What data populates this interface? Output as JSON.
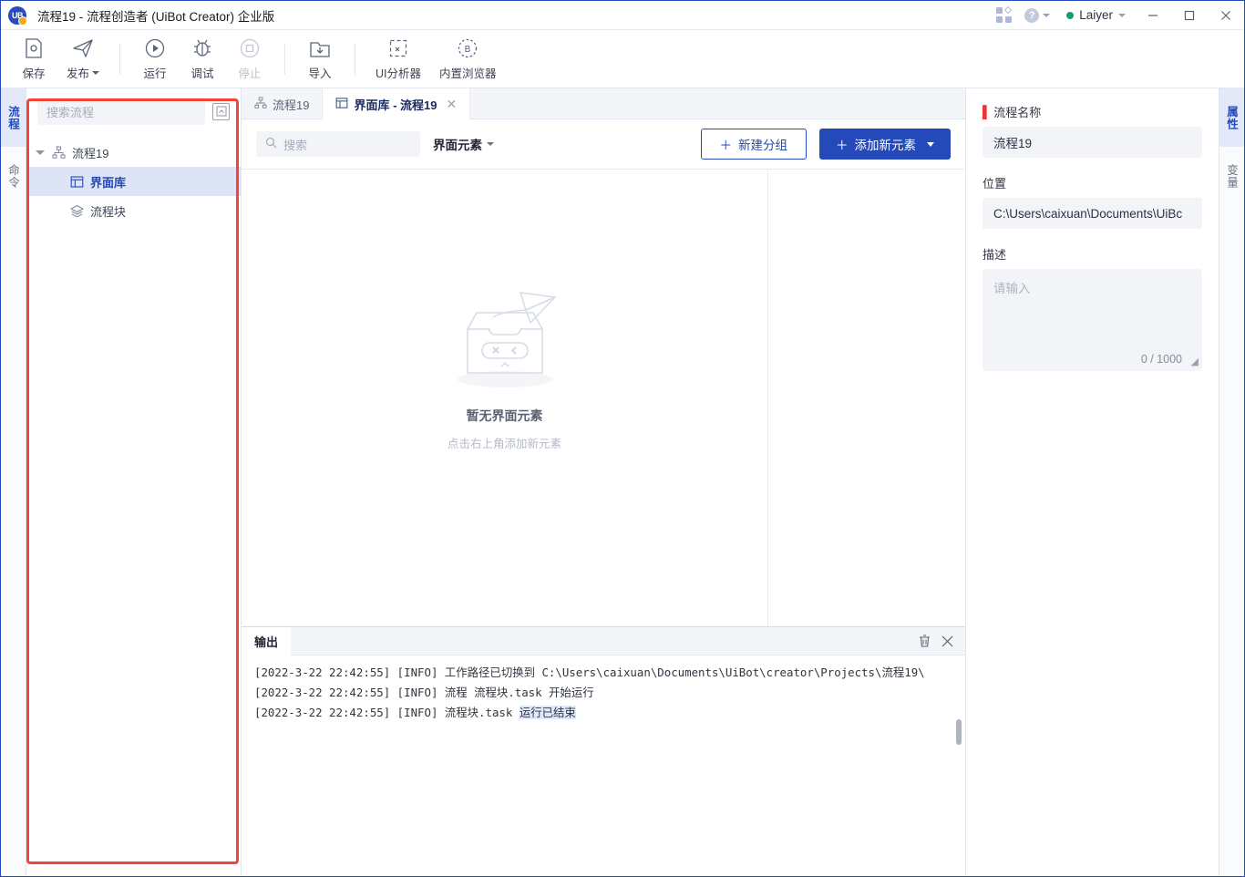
{
  "titlebar": {
    "app_title": "流程19 - 流程创造者 (UiBot Creator) 企业版",
    "logo_text": "UB",
    "apps_icon": "apps-grid-icon",
    "help_icon": "help-circle-icon",
    "user_name": "Laiyer",
    "minimize": "minimize-icon",
    "maximize": "maximize-icon",
    "close": "close-icon"
  },
  "toolbar": {
    "items": [
      {
        "label": "保存",
        "icon": "save-icon",
        "disabled": false,
        "caret": false
      },
      {
        "label": "发布",
        "icon": "publish-icon",
        "disabled": false,
        "caret": true
      },
      {
        "label": "运行",
        "icon": "run-icon",
        "disabled": false,
        "caret": false
      },
      {
        "label": "调试",
        "icon": "debug-icon",
        "disabled": false,
        "caret": false
      },
      {
        "label": "停止",
        "icon": "stop-icon",
        "disabled": true,
        "caret": false
      },
      {
        "label": "导入",
        "icon": "import-icon",
        "disabled": false,
        "caret": false
      },
      {
        "label": "UI分析器",
        "icon": "ui-analyzer-icon",
        "disabled": false,
        "caret": false
      },
      {
        "label": "内置浏览器",
        "icon": "browser-icon",
        "disabled": false,
        "caret": false
      }
    ]
  },
  "left_rail": {
    "items": [
      {
        "label": "流程",
        "active": true
      },
      {
        "label": "命令",
        "active": false
      }
    ]
  },
  "right_rail": {
    "items": [
      {
        "label": "属性",
        "active": true
      },
      {
        "label": "变量",
        "active": false
      }
    ]
  },
  "sidebar": {
    "search_placeholder": "搜索流程",
    "collapse_icon": "collapse-all-icon",
    "tree": {
      "root_label": "流程19",
      "root_icon": "sitemap-icon",
      "children": [
        {
          "label": "界面库",
          "icon": "ui-library-icon",
          "selected": true
        },
        {
          "label": "流程块",
          "icon": "layers-icon",
          "selected": false
        }
      ]
    }
  },
  "tabs": [
    {
      "label": "流程19",
      "icon": "sitemap-icon",
      "active": false,
      "closable": false
    },
    {
      "label": "界面库 - 流程19",
      "icon": "ui-library-icon",
      "active": true,
      "closable": true,
      "close_glyph": "✕"
    }
  ],
  "content_toolbar": {
    "search_placeholder": "搜索",
    "search_icon": "search-icon",
    "filter_label": "界面元素",
    "new_group_label": "新建分组",
    "new_group_plus": "＋",
    "add_element_label": "添加新元素",
    "add_element_plus": "＋"
  },
  "empty_state": {
    "illustration": "empty-box-paper-plane-illustration",
    "title": "暂无界面元素",
    "subtitle": "点击右上角添加新元素"
  },
  "output": {
    "tab_label": "输出",
    "clear_icon": "trash-icon",
    "close_icon": "close-icon",
    "lines": [
      {
        "text": "[2022-3-22 22:42:55] [INFO] 工作路径已切换到 C:\\Users\\caixuan\\Documents\\UiBot\\creator\\Projects\\流程19\\",
        "highlight": ""
      },
      {
        "text": "[2022-3-22 22:42:55] [INFO] 流程 流程块.task 开始运行",
        "highlight": ""
      },
      {
        "text": "[2022-3-22 22:42:55] [INFO] 流程块.task ",
        "highlight": "运行已结束"
      }
    ]
  },
  "properties": {
    "name_label": "流程名称",
    "name_required": "▌",
    "name_value": "流程19",
    "location_label": "位置",
    "location_value": "C:\\Users\\caixuan\\Documents\\UiBc",
    "desc_label": "描述",
    "desc_placeholder": "请输入",
    "desc_counter": "0 / 1000"
  },
  "annotation": {
    "color": "#f4433a",
    "target": "process-tree-panel"
  },
  "colors": {
    "accent": "#2449b8",
    "selected_row": "#dde4f5",
    "panel_bg": "#f2f4f8",
    "annotation": "#f4433a",
    "online_dot": "#13a06a"
  }
}
